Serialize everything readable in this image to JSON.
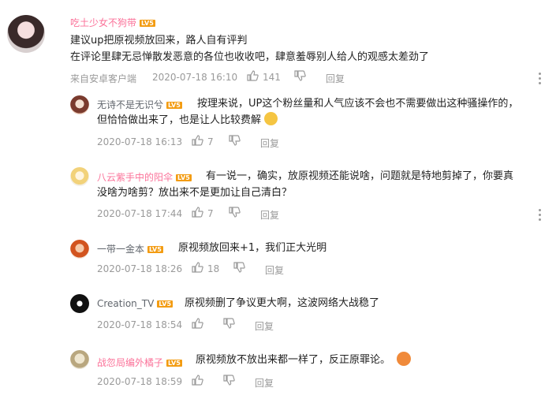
{
  "colors": {
    "vip_pink": "#fb7299",
    "username_gray": "#61666d",
    "meta_gray": "#9a9a9a",
    "level_badge": "#f39c12"
  },
  "main_comment": {
    "username": "吃土少女不狗带",
    "level": "LV5",
    "line1": "建议up把原视频放回来，路人自有评判",
    "line2": "在评论里肆无忌惮散发恶意的各位也收收吧，肆意羞辱别人给人的观感太差劲了",
    "source": "来自安卓客户端",
    "time": "2020-07-18 16:10",
    "likes": "141",
    "reply_label": "回复"
  },
  "replies": [
    {
      "username": "无诗不是无识兮",
      "level": "LV5",
      "line1": "按理来说，UP这个粉丝量和人气应该不会也不需要做出这种骚操作的，",
      "line2": "但恰恰做出来了，也是让人比较费解",
      "time": "2020-07-18 16:13",
      "likes": "7",
      "reply_label": "回复"
    },
    {
      "username": "八云紫手中的阳伞",
      "level": "LV5",
      "line1": "有一说一，确实，放原视频还能说啥，问题就是特地剪掉了，你要真",
      "line2": "没啥为啥剪？放出来不是更加让自己清白？",
      "time": "2020-07-18 17:44",
      "likes": "7",
      "reply_label": "回复"
    },
    {
      "username": "一带一金本",
      "level": "LV5",
      "line1": "原视频放回来+1，我们正大光明",
      "time": "2020-07-18 18:26",
      "likes": "18",
      "reply_label": "回复"
    },
    {
      "username": "Creation_TV",
      "level": "LV5",
      "line1": "原视频删了争议更大啊，这波网络大战稳了",
      "time": "2020-07-18 18:54",
      "likes": "",
      "reply_label": "回复"
    },
    {
      "username": "战忽局编外橘子",
      "level": "LV5",
      "line1": "原视频放不放出来都一样了，反正原罪论。",
      "time": "2020-07-18 18:59",
      "likes": "",
      "reply_label": "回复"
    }
  ]
}
